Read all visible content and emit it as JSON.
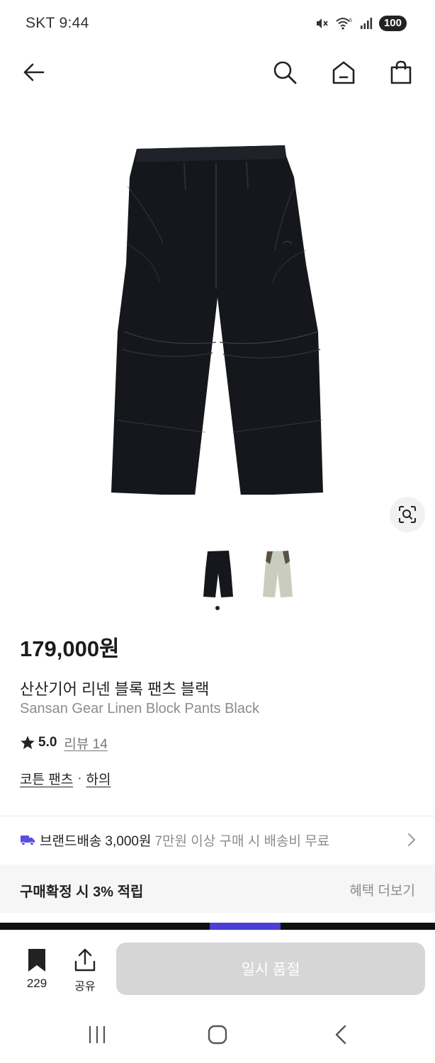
{
  "status_bar": {
    "carrier": "SKT",
    "time": "9:44",
    "battery": "100",
    "icons": [
      "mute-icon",
      "wifi-icon",
      "signal-icon",
      "battery-icon"
    ]
  },
  "top_nav": {
    "icons": [
      "back-arrow-icon",
      "search-icon",
      "home-icon",
      "shopping-bag-icon"
    ]
  },
  "product": {
    "price": "179,000원",
    "name_ko": "산산기어 리넨 블록 팬츠 블랙",
    "name_en": "Sansan Gear Linen Block Pants Black",
    "rating": "5.0",
    "review_label": "리뷰 14",
    "category": "코튼 팬츠",
    "category_separator": "·",
    "subcategory": "하의",
    "color_options": [
      "black",
      "khaki"
    ],
    "selected_option_index": 0
  },
  "shipping": {
    "brand_label": "브랜드배송",
    "fee": "3,000원",
    "note": "7만원 이상 구매 시 배송비 무료"
  },
  "benefit": {
    "label": "구매확정 시 3% 적립",
    "more_label": "혜택 더보기"
  },
  "bottom_bar": {
    "bookmark_count": "229",
    "share_label": "공유",
    "sold_out_label": "일시 품절"
  },
  "colors": {
    "accent_purple": "#4b3fd6",
    "disabled_button": "#d6d6d6",
    "text_primary": "#222222",
    "text_secondary": "#8c8c8c",
    "product_black": "#15171c",
    "product_khaki": "#c9cdbd"
  }
}
